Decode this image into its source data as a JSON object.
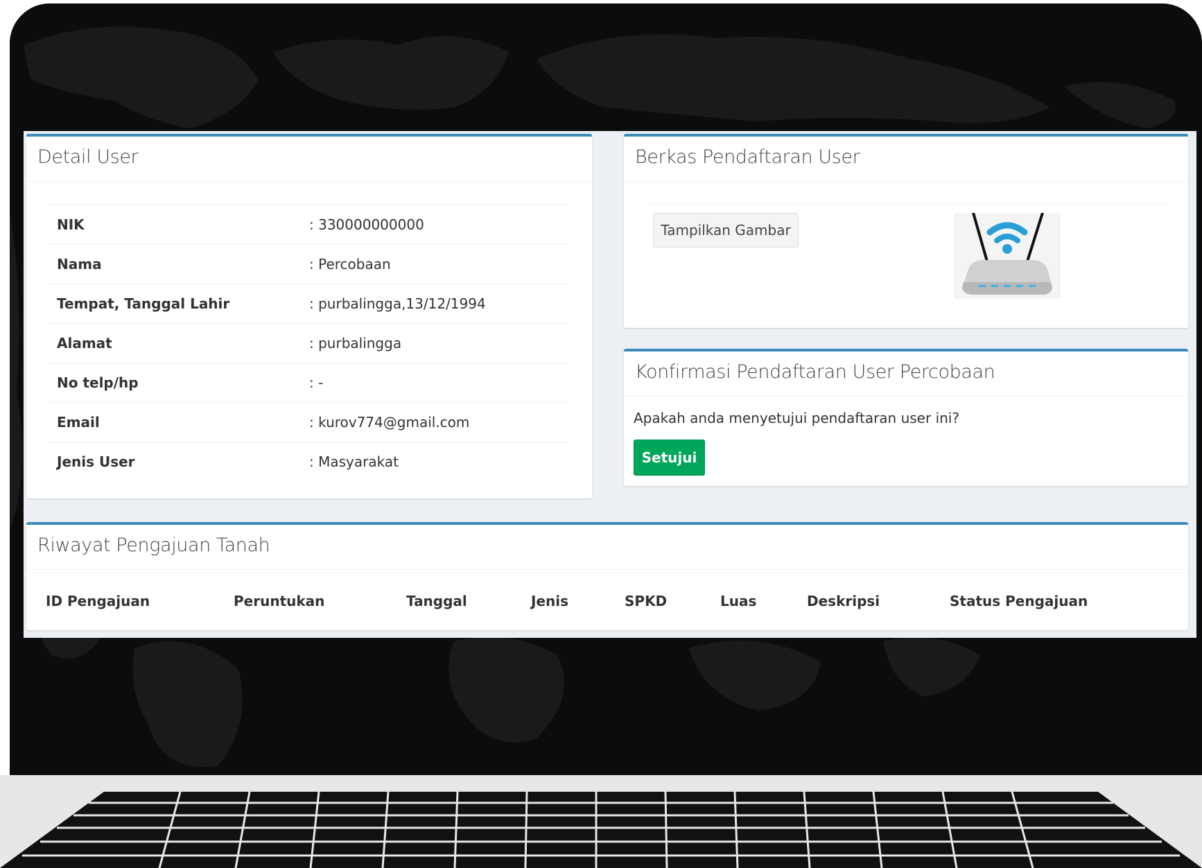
{
  "detail_user": {
    "title": "Detail User",
    "rows": [
      {
        "label": "NIK",
        "value": ": 330000000000"
      },
      {
        "label": "Nama",
        "value": ": Percobaan"
      },
      {
        "label": "Tempat, Tanggal Lahir",
        "value": ": purbalingga,13/12/1994"
      },
      {
        "label": "Alamat",
        "value": ": purbalingga"
      },
      {
        "label": "No telp/hp",
        "value": ": -"
      },
      {
        "label": "Email",
        "value": ": kurov774@gmail.com"
      },
      {
        "label": "Jenis User",
        "value": ": Masyarakat"
      }
    ]
  },
  "berkas": {
    "title": "Berkas Pendaftaran User",
    "show_image_button": "Tampilkan Gambar",
    "image_icon": "wifi-router-icon"
  },
  "konfirmasi": {
    "title": "Konfirmasi Pendaftaran User Percobaan",
    "question": "Apakah anda menyetujui pendaftaran user ini?",
    "approve_button": "Setujui"
  },
  "riwayat": {
    "title": "Riwayat Pengajuan Tanah",
    "columns": [
      "ID Pengajuan",
      "Peruntukan",
      "Tanggal",
      "Jenis",
      "SPKD",
      "Luas",
      "Deskripsi",
      "Status Pengajuan"
    ]
  },
  "colors": {
    "box_border": "#3c8dbc",
    "success": "#00a65a",
    "screen_bg": "#ecf0f5",
    "laptop_bg": "#0b0b0b"
  }
}
